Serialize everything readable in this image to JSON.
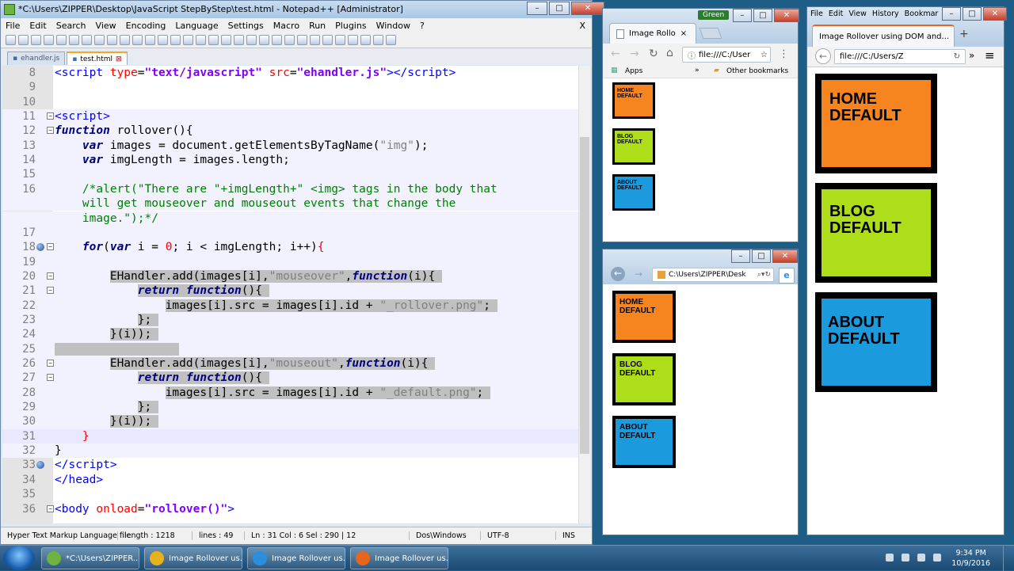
{
  "npp": {
    "title": "*C:\\Users\\ZIPPER\\Desktop\\JavaScript StepByStep\\test.html - Notepad++ [Administrator]",
    "menu": [
      "File",
      "Edit",
      "Search",
      "View",
      "Encoding",
      "Language",
      "Settings",
      "Macro",
      "Run",
      "Plugins",
      "Window",
      "?"
    ],
    "close_x": "X",
    "tabs": [
      {
        "label": "ehandler.js",
        "active": false
      },
      {
        "label": "test.html",
        "active": true
      }
    ],
    "status": {
      "filetype": "Hyper Text Markup Language file",
      "length": "length : 1218",
      "lines": "lines : 49",
      "position": "Ln : 31    Col : 6    Sel : 290 | 12",
      "eol": "Dos\\Windows",
      "encoding": "UTF-8",
      "mode": "INS"
    }
  },
  "code_lines": [
    {
      "n": "8",
      "html": "<span class=\"tag\">&lt;script</span> <span class=\"attr\">type</span>=<span class=\"str\">\"text/javascript\"</span> <span class=\"attr\">src</span>=<span class=\"str\">\"ehandler.js\"</span><span class=\"tag\">&gt;&lt;/script&gt;</span>"
    },
    {
      "n": "9",
      "html": ""
    },
    {
      "n": "10",
      "html": ""
    },
    {
      "n": "11",
      "html": "<span class=\"tag\">&lt;script&gt;</span>",
      "fold": "−"
    },
    {
      "n": "12",
      "html": "<span class=\"kwi\">function</span> rollover(){",
      "fold": "−"
    },
    {
      "n": "13",
      "html": "    <span class=\"kwi\">var</span> images = document.getElementsByTagName(<span class=\"str2\">\"img\"</span>);"
    },
    {
      "n": "14",
      "html": "    <span class=\"kwi\">var</span> imgLength = images.length;"
    },
    {
      "n": "15",
      "html": ""
    },
    {
      "n": "16",
      "html": "    <span class=\"cm\">/*alert(\"There are \"+imgLength+\" &lt;img&gt; tags in the body that</span>"
    },
    {
      "n": "",
      "html": "    <span class=\"cm\">will get mouseover and mouseout events that change the</span>"
    },
    {
      "n": "",
      "html": "    <span class=\"cm\">image.\");*/</span>"
    },
    {
      "n": "17",
      "html": ""
    },
    {
      "n": "18",
      "html": "    <span class=\"kwi\">for</span>(<span class=\"kwi\">var</span> i = <span class=\"num2\">0</span>; i &lt; imgLength; i++)<span class=\"attr\">{</span>",
      "fold": "−",
      "bm": true
    },
    {
      "n": "19",
      "html": ""
    },
    {
      "n": "20",
      "html": "        <span class=\"selbg\">EHandler.add(images[i],<span class=\"str2\">\"mouseover\"</span>,<span class=\"kwi\">function</span>(i){ </span>",
      "fold": "−",
      "sel": true
    },
    {
      "n": "21",
      "html": "            <span class=\"selbg\"><span class=\"kwi\">return</span> <span class=\"kwi\">function</span>(){ </span>",
      "fold": "−",
      "sel": true
    },
    {
      "n": "22",
      "html": "                <span class=\"selbg\">images[i].src = images[i].id + <span class=\"str2\">\"_rollover.png\"</span>; </span>",
      "sel": true
    },
    {
      "n": "23",
      "html": "            <span class=\"selbg\">}; </span>",
      "sel": true
    },
    {
      "n": "24",
      "html": "        <span class=\"selbg\">}(i)); </span>",
      "sel": true
    },
    {
      "n": "25",
      "html": "<span class=\"selbg\">                  </span>",
      "sel": true
    },
    {
      "n": "26",
      "html": "        <span class=\"selbg\">EHandler.add(images[i],<span class=\"str2\">\"mouseout\"</span>,<span class=\"kwi\">function</span>(i){ </span>",
      "fold": "−",
      "sel": true
    },
    {
      "n": "27",
      "html": "            <span class=\"selbg\"><span class=\"kwi\">return</span> <span class=\"kwi\">function</span>(){ </span>",
      "fold": "−",
      "sel": true
    },
    {
      "n": "28",
      "html": "                <span class=\"selbg\">images[i].src = images[i].id + <span class=\"str2\">\"_default.png\"</span>; </span>",
      "sel": true
    },
    {
      "n": "29",
      "html": "            <span class=\"selbg\">}; </span>",
      "sel": true
    },
    {
      "n": "30",
      "html": "        <span class=\"selbg\">}(i)); </span>",
      "sel": true
    },
    {
      "n": "31",
      "html": "    <span class=\"attr\">}</span>",
      "cur": true
    },
    {
      "n": "32",
      "html": "}"
    },
    {
      "n": "33",
      "html": "<span class=\"tag\">&lt;/script&gt;</span>",
      "bm": true
    },
    {
      "n": "34",
      "html": "<span class=\"tag\">&lt;/head&gt;</span>"
    },
    {
      "n": "35",
      "html": ""
    },
    {
      "n": "36",
      "html": "<span class=\"tag\">&lt;body</span> <span class=\"attr\">onload</span>=<span class=\"str\">\"rollover()\"</span><span class=\"tag\">&gt;</span>",
      "fold": "−"
    }
  ],
  "chrome1": {
    "profile": "Green",
    "tab": "Image Rollo",
    "tab_close": "×",
    "address": "file:///C:/User",
    "bookmarks": {
      "apps": "Apps",
      "more": "»",
      "other": "Other bookmarks"
    },
    "boxes": [
      {
        "line1": "HOME",
        "line2": "DEFAULT",
        "color": "#f7851f"
      },
      {
        "line1": "BLOG",
        "line2": "DEFAULT",
        "color": "#aedd19"
      },
      {
        "line1": "ABOUT",
        "line2": "DEFAULT",
        "color": "#1b9bde"
      }
    ]
  },
  "ie": {
    "address": "C:\\Users\\ZIPPER\\Desk",
    "boxes": [
      {
        "line1": "HOME",
        "line2": "DEFAULT"
      },
      {
        "line1": "BLOG",
        "line2": "DEFAULT"
      },
      {
        "line1": "ABOUT",
        "line2": "DEFAULT"
      }
    ]
  },
  "firefox": {
    "menu": [
      "File",
      "Edit",
      "View",
      "History",
      "Bookmar"
    ],
    "tab": "Image Rollover using DOM and...",
    "tab_close": "×",
    "new_tab": "+",
    "address": "file:///C:/Users/Z",
    "more": "»",
    "boxes": [
      {
        "line1": "HOME",
        "line2": "DEFAULT"
      },
      {
        "line1": "BLOG",
        "line2": "DEFAULT"
      },
      {
        "line1": "ABOUT",
        "line2": "DEFAULT"
      }
    ]
  },
  "taskbar": {
    "items": [
      {
        "label": "*C:\\Users\\ZIPPER...",
        "color": "#6cb33f"
      },
      {
        "label": "Image Rollover us...",
        "color": "#e8b21c"
      },
      {
        "label": "Image Rollover us...",
        "color": "#2b8fe0"
      },
      {
        "label": "Image Rollover us...",
        "color": "#e8661c"
      }
    ],
    "time": "9:34 PM",
    "date": "10/9/2016"
  }
}
